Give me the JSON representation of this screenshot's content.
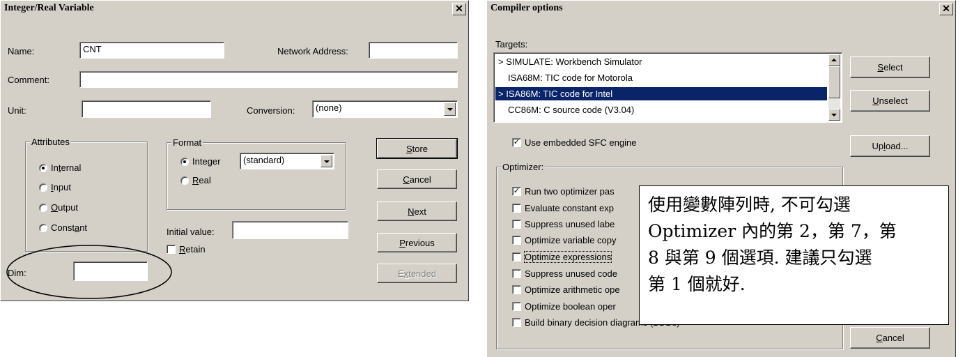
{
  "left_dialog": {
    "title": "Integer/Real Variable",
    "close_glyph": "✕",
    "name_label": "Name:",
    "name_value": "CNT",
    "network_address_label": "Network Address:",
    "network_address_value": "",
    "comment_label": "Comment:",
    "comment_value": "",
    "unit_label": "Unit:",
    "unit_value": "",
    "conversion_label": "Conversion:",
    "conversion_value": "(none)",
    "attributes": {
      "group_label": "Attributes",
      "options": [
        {
          "pre": "In",
          "key": "t",
          "post": "ernal",
          "selected": true
        },
        {
          "pre": "",
          "key": "I",
          "post": "nput",
          "selected": false
        },
        {
          "pre": "",
          "key": "O",
          "post": "utput",
          "selected": false
        },
        {
          "pre": "Const",
          "key": "a",
          "post": "nt",
          "selected": false
        }
      ]
    },
    "format": {
      "group_label": "Format",
      "options": [
        {
          "pre": "Inte",
          "key": "g",
          "post": "er",
          "selected": true
        },
        {
          "pre": "",
          "key": "R",
          "post": "eal",
          "selected": false
        }
      ],
      "integer_style_value": "(standard)"
    },
    "initial_value_label": "Initial value:",
    "initial_value": "",
    "retain": {
      "pre": "",
      "key": "R",
      "post": "etain",
      "checked": false
    },
    "dim_label": "Dim:",
    "dim_value": "",
    "buttons": {
      "store": {
        "pre": "",
        "key": "S",
        "post": "tore"
      },
      "cancel": {
        "pre": "",
        "key": "C",
        "post": "ancel"
      },
      "next": {
        "pre": "",
        "key": "N",
        "post": "ext"
      },
      "previous": {
        "pre": "",
        "key": "P",
        "post": "revious"
      },
      "extended": {
        "pre": "E",
        "key": "x",
        "post": "tended"
      }
    }
  },
  "right_dialog": {
    "title": "Compiler options",
    "close_glyph": "✕",
    "targets_label": "Targets:",
    "targets": [
      {
        "text": "> SIMULATE: Workbench Simulator",
        "selected": false
      },
      {
        "text": "ISA68M: TIC code for Motorola",
        "selected": false
      },
      {
        "text": "> ISA86M: TIC code for Intel",
        "selected": true
      },
      {
        "text": "CC86M: C source code (V3.04)",
        "selected": false
      }
    ],
    "buttons": {
      "select": {
        "pre": "",
        "key": "S",
        "post": "elect"
      },
      "unselect": {
        "pre": "",
        "key": "U",
        "post": "nselect"
      },
      "upload": {
        "pre": "Up",
        "key": "l",
        "post": "oad..."
      },
      "cancel": {
        "pre": "",
        "key": "C",
        "post": "ancel"
      }
    },
    "use_sfc_engine": {
      "label": "Use embedded SFC engine",
      "checked": true
    },
    "optimizer_label": "Optimizer:",
    "optimizer_options": [
      {
        "label": "Run two optimizer pas",
        "checked": true
      },
      {
        "label": "Evaluate constant exp",
        "checked": false
      },
      {
        "label": "Suppress unused labe",
        "checked": false
      },
      {
        "label": "Optimize variable copy",
        "checked": false
      },
      {
        "label": "Optimize expressions",
        "checked": false
      },
      {
        "label": "Suppress unused code",
        "checked": false
      },
      {
        "label": "Optimize arithmetic ope",
        "checked": false
      },
      {
        "label": "Optimize boolean oper",
        "checked": false
      },
      {
        "label": "Build binary decision diagrams (BDDs)",
        "checked": false
      }
    ],
    "checkmark_glyph": "✓"
  },
  "callout": {
    "line1": "使用變數陣列時, 不可勾選",
    "line2": "Optimizer 內的第 2，第 7，第",
    "line3": "8 與第 9 個選項. 建議只勾選",
    "line4": "第 1 個就好."
  }
}
